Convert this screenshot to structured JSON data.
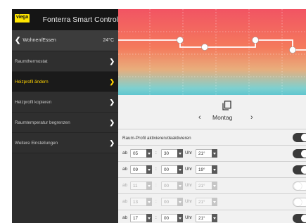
{
  "header": {
    "app_title": "Fonterra Smart Control",
    "logo_text": "viega"
  },
  "room": {
    "name": "Wohnen/Essen",
    "temperature": "24°C"
  },
  "sidebar": {
    "items": [
      {
        "label": "Raumthermostat",
        "active": false
      },
      {
        "label": "Heizprofil ändern",
        "active": true
      },
      {
        "label": "Heizprofil kopieren",
        "active": false
      },
      {
        "label": "Raumtemperatur begrenzen",
        "active": false
      },
      {
        "label": "Weitere Einstellungen",
        "active": false
      }
    ]
  },
  "day_nav": {
    "day": "Montag",
    "prev": "‹",
    "next": "›"
  },
  "profile": {
    "activate_label": "Raum-Profil aktivieren/deaktivieren",
    "enabled": true
  },
  "schedule": {
    "prefix": "ab",
    "separator": ":",
    "unit": "Uhr",
    "rows": [
      {
        "hour": "05",
        "minute": "30",
        "temp": "21°",
        "enabled": true
      },
      {
        "hour": "09",
        "minute": "00",
        "temp": "19°",
        "enabled": true
      },
      {
        "hour": "11",
        "minute": "00",
        "temp": "21°",
        "enabled": false
      },
      {
        "hour": "13",
        "minute": "00",
        "temp": "21°",
        "enabled": false
      },
      {
        "hour": "17",
        "minute": "00",
        "temp": "21°",
        "enabled": true
      }
    ]
  },
  "colors": {
    "accent": "#ffd400",
    "sidebar_bg": "#2d2d2d",
    "gradient_top": "#f25463",
    "gradient_bottom": "#5fc6cf"
  }
}
